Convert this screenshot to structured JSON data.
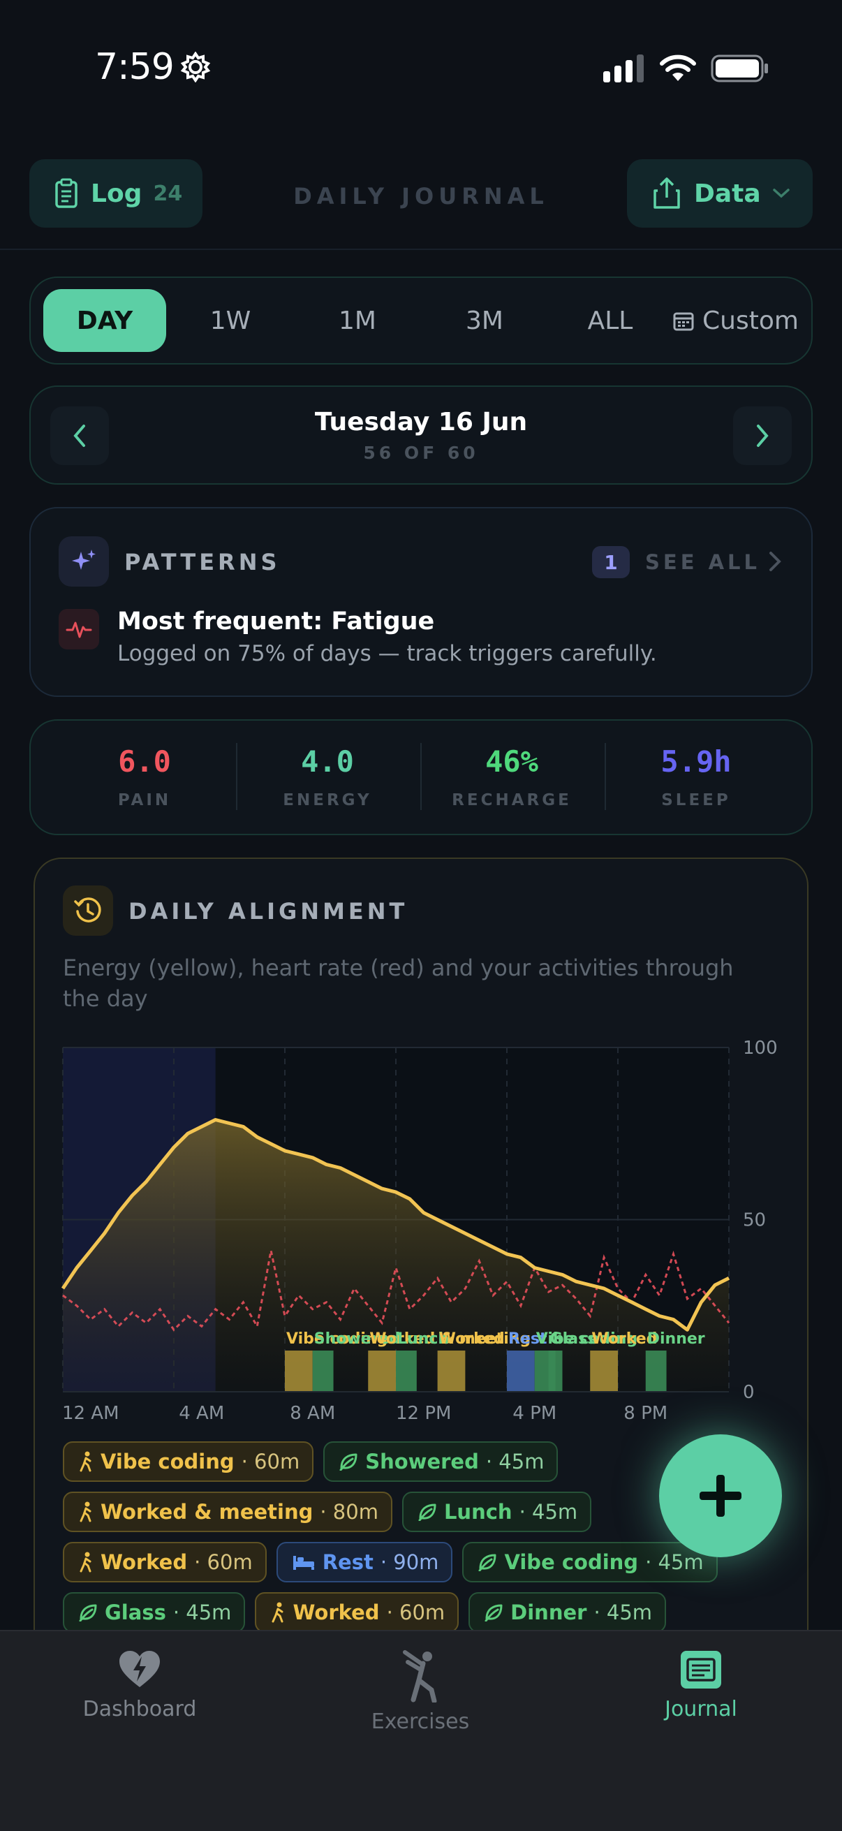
{
  "status_bar": {
    "time": "7:59"
  },
  "header": {
    "log_label": "Log",
    "log_count": "24",
    "title": "DAILY JOURNAL",
    "data_label": "Data"
  },
  "range": {
    "options": [
      "DAY",
      "1W",
      "1M",
      "3M",
      "ALL"
    ],
    "custom_label": "Custom",
    "selected": "DAY"
  },
  "date_nav": {
    "date": "Tuesday 16 Jun",
    "position": "56 OF 60"
  },
  "patterns": {
    "title": "PATTERNS",
    "count": "1",
    "see_all": "SEE ALL",
    "headline": "Most frequent: Fatigue",
    "detail": "Logged on 75% of days — track triggers carefully."
  },
  "metrics": [
    {
      "value": "6.0",
      "label": "PAIN",
      "color": "#f0565e"
    },
    {
      "value": "4.0",
      "label": "ENERGY",
      "color": "#5ccfa5"
    },
    {
      "value": "46%",
      "label": "RECHARGE",
      "color": "#4fd97c"
    },
    {
      "value": "5.9h",
      "label": "SLEEP",
      "color": "#6664f2"
    }
  ],
  "alignment": {
    "title": "DAILY ALIGNMENT",
    "description": "Energy (yellow), heart rate (red) and your activities through the day"
  },
  "chart_data": {
    "type": "line",
    "x_range_hours": [
      0,
      24
    ],
    "ylim": [
      0,
      100
    ],
    "y_ticks": [
      0,
      50,
      100
    ],
    "x_tick_labels": [
      "12 AM",
      "4 AM",
      "8 AM",
      "12 PM",
      "4 PM",
      "8 PM"
    ],
    "sleep_shade_hours": [
      0,
      5.5
    ],
    "grid": true,
    "series": [
      {
        "color": "#f2c453",
        "x": [
          0,
          0.5,
          1,
          1.5,
          2,
          2.5,
          3,
          3.5,
          4,
          4.5,
          5,
          5.5,
          6,
          6.5,
          7,
          7.5,
          8,
          8.5,
          9,
          9.5,
          10,
          10.5,
          11,
          11.5,
          12,
          12.5,
          13,
          13.5,
          14,
          14.5,
          15,
          15.5,
          16,
          16.5,
          17,
          17.5,
          18,
          18.5,
          19,
          19.5,
          20,
          20.5,
          21,
          21.5,
          22,
          22.5,
          23,
          23.5,
          24
        ],
        "values": [
          30,
          36,
          41,
          46,
          52,
          57,
          61,
          66,
          71,
          75,
          77,
          79,
          78,
          77,
          74,
          72,
          70,
          69,
          68,
          66,
          65,
          63,
          61,
          59,
          58,
          56,
          52,
          50,
          48,
          46,
          44,
          42,
          40,
          39,
          36,
          35,
          34,
          32,
          31,
          30,
          28,
          26,
          24,
          22,
          21,
          18,
          26,
          31,
          33
        ]
      },
      {
        "color": "#e8505b",
        "x": [
          0,
          0.5,
          1,
          1.5,
          2,
          2.5,
          3,
          3.5,
          4,
          4.5,
          5,
          5.5,
          6,
          6.5,
          7,
          7.5,
          8,
          8.5,
          9,
          9.5,
          10,
          10.5,
          11,
          11.5,
          12,
          12.5,
          13,
          13.5,
          14,
          14.5,
          15,
          15.5,
          16,
          16.5,
          17,
          17.5,
          18,
          18.5,
          19,
          19.5,
          20,
          20.5,
          21,
          21.5,
          22,
          22.5,
          23,
          23.5,
          24
        ],
        "values": [
          28,
          25,
          21,
          24,
          19,
          23,
          20,
          24,
          18,
          22,
          19,
          24,
          21,
          26,
          19,
          41,
          22,
          28,
          24,
          26,
          21,
          30,
          25,
          20,
          36,
          24,
          28,
          33,
          26,
          30,
          38,
          28,
          32,
          25,
          36,
          29,
          31,
          27,
          22,
          39,
          30,
          26,
          34,
          28,
          40,
          27,
          30,
          25,
          20
        ]
      }
    ],
    "activity_labels": [
      "Vibe coding",
      "Showered",
      "Worked & meeting",
      "Lunch",
      "Worked",
      "Rest",
      "Vibe coding",
      "Glass",
      "Worked",
      "Dinner"
    ]
  },
  "activities": [
    {
      "name": "Vibe coding",
      "duration": "· 60m",
      "kind": "work"
    },
    {
      "name": "Showered",
      "duration": "· 45m",
      "kind": "care"
    },
    {
      "name": "Worked & meeting",
      "duration": "· 80m",
      "kind": "work"
    },
    {
      "name": "Lunch",
      "duration": "· 45m",
      "kind": "care"
    },
    {
      "name": "Worked",
      "duration": "· 60m",
      "kind": "work"
    },
    {
      "name": "Rest",
      "duration": "· 90m",
      "kind": "rest"
    },
    {
      "name": "Vibe coding",
      "duration": "· 45m",
      "kind": "care"
    },
    {
      "name": "Glass",
      "duration": "· 45m",
      "kind": "care"
    },
    {
      "name": "Worked",
      "duration": "· 60m",
      "kind": "work"
    },
    {
      "name": "Dinner",
      "duration": "· 45m",
      "kind": "care"
    }
  ],
  "activity_blocks": [
    {
      "start_hour": 8.0,
      "end_hour": 9.0,
      "kind": "work"
    },
    {
      "start_hour": 9.0,
      "end_hour": 9.75,
      "kind": "care"
    },
    {
      "start_hour": 11.0,
      "end_hour": 12.0,
      "kind": "work"
    },
    {
      "start_hour": 12.0,
      "end_hour": 12.75,
      "kind": "care"
    },
    {
      "start_hour": 13.5,
      "end_hour": 14.5,
      "kind": "work"
    },
    {
      "start_hour": 16.0,
      "end_hour": 17.0,
      "kind": "rest"
    },
    {
      "start_hour": 17.0,
      "end_hour": 17.75,
      "kind": "care"
    },
    {
      "start_hour": 17.5,
      "end_hour": 18.0,
      "kind": "care"
    },
    {
      "start_hour": 19.0,
      "end_hour": 20.0,
      "kind": "work"
    },
    {
      "start_hour": 21.0,
      "end_hour": 21.75,
      "kind": "care"
    }
  ],
  "colors": {
    "accent": "#5ccfa5",
    "work": "#f0c24b",
    "care": "#5ccd7c",
    "rest": "#5f95f0"
  },
  "tabs": [
    {
      "label": "Dashboard",
      "icon": "heart-bolt-icon",
      "active": false
    },
    {
      "label": "Exercises",
      "icon": "stretch-figure-icon",
      "active": false
    },
    {
      "label": "Journal",
      "icon": "journal-icon",
      "active": true
    }
  ]
}
